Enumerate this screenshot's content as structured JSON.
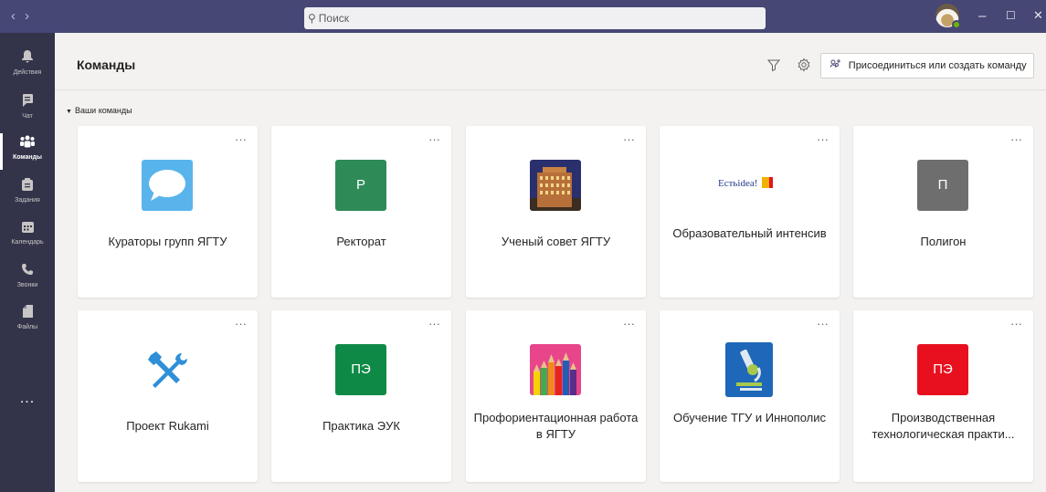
{
  "search": {
    "placeholder": "Поиск"
  },
  "rail": {
    "items": [
      {
        "label": "Действия",
        "icon": "bell-icon"
      },
      {
        "label": "Чат",
        "icon": "chat-icon"
      },
      {
        "label": "Команды",
        "icon": "teams-icon",
        "active": true
      },
      {
        "label": "Задания",
        "icon": "assignments-icon"
      },
      {
        "label": "Календарь",
        "icon": "calendar-icon"
      },
      {
        "label": "Звонки",
        "icon": "phone-icon"
      },
      {
        "label": "Файлы",
        "icon": "files-icon"
      }
    ],
    "more": "..."
  },
  "header": {
    "title": "Команды",
    "join_label": "Присоединиться или создать команду"
  },
  "section": {
    "label": "Ваши команды"
  },
  "teams": [
    {
      "name": "Кураторы групп ЯГТУ",
      "logo": "speech-bubble"
    },
    {
      "name": "Ректорат",
      "logo": "letter",
      "letter": "Р",
      "color": "#2e8b57"
    },
    {
      "name": "Ученый совет ЯГТУ",
      "logo": "building-photo"
    },
    {
      "name": "Образовательный интенсив",
      "logo": "emblem",
      "logo_text": "Естьidea!"
    },
    {
      "name": "Полигон",
      "logo": "letter",
      "letter": "П",
      "color": "#6e6e6e"
    },
    {
      "name": "Проект Rukami",
      "logo": "tools-icon"
    },
    {
      "name": "Практика ЭУК",
      "logo": "letter",
      "letter": "ПЭ",
      "color": "#0f8a46"
    },
    {
      "name": "Профориентационная работа в ЯГТУ",
      "logo": "pencils-photo"
    },
    {
      "name": "Обучение ТГУ и Иннополис",
      "logo": "microscope-icon"
    },
    {
      "name": "Производственная технологическая практи...",
      "logo": "letter",
      "letter": "ПЭ",
      "color": "#e8101f"
    }
  ],
  "colors": {
    "title_bar": "#464775",
    "rail": "#33344a",
    "page_bg": "#f3f2f1"
  }
}
